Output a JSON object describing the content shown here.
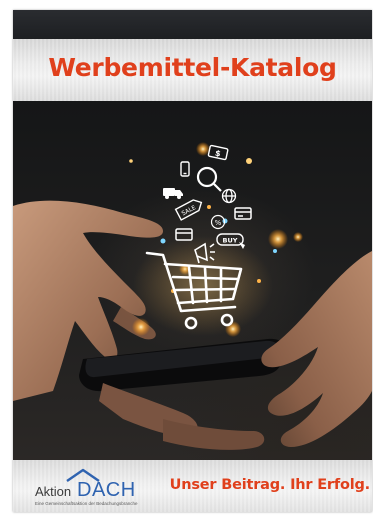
{
  "cover": {
    "title": "Werbemittel-Katalog",
    "title_color": "#e0401c",
    "slogan": "Unser Beitrag. Ihr Erfolg.",
    "slogan_color": "#e0401c"
  },
  "logo": {
    "aktion": "Aktion",
    "dach": "DACH",
    "dach_color": "#2f63b0",
    "subline": "Eine Gemeinschaftsaktion der Bedachungsbranche"
  },
  "illustration": {
    "sale_tag": "SALE",
    "buy_label": "BUY",
    "percent_label": "%",
    "dollar_label": "$",
    "icons": [
      "shopping-cart-icon",
      "search-icon",
      "globe-icon",
      "sale-tag-icon",
      "buy-button-icon",
      "megaphone-icon",
      "credit-card-icon",
      "dollar-bill-icon",
      "smartphone-icon",
      "delivery-truck-icon",
      "percent-icon"
    ],
    "glow_color": "#ffb347"
  }
}
